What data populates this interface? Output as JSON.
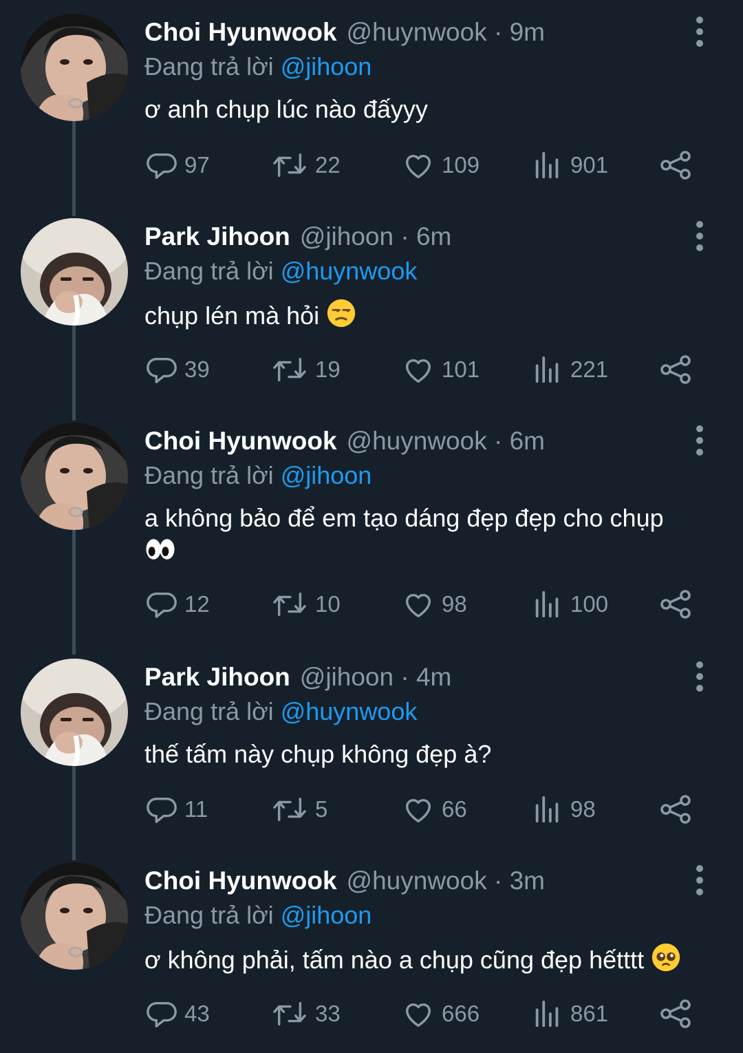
{
  "colors": {
    "background": "#15202b",
    "text": "#ffffff",
    "secondary": "#8b98a5",
    "mention": "#1d9bf0",
    "thread_line": "#3d4a57"
  },
  "icons": {
    "reply": "speech-bubble-icon",
    "retweet": "retweet-icon",
    "like": "heart-icon",
    "views": "bar-chart-icon",
    "share": "share-icon",
    "more": "more-vertical-icon"
  },
  "tweets": [
    {
      "name": "Choi Hyunwook",
      "meta": "@huynwook · 9m",
      "reply_prefix": "Đang trả lời",
      "reply_to": "@jihoon",
      "text": "ơ anh chụp lúc nào đấyyy",
      "emoji": "",
      "replies": "97",
      "retweets": "22",
      "likes": "109",
      "views": "901"
    },
    {
      "name": "Park Jihoon",
      "meta": "@jihoon · 6m",
      "reply_prefix": "Đang trả lời",
      "reply_to": "@huynwook",
      "text": "chụp lén mà hỏi",
      "emoji": "unamused-face",
      "replies": "39",
      "retweets": "19",
      "likes": "101",
      "views": "221"
    },
    {
      "name": "Choi Hyunwook",
      "meta": "@huynwook · 6m",
      "reply_prefix": "Đang trả lời",
      "reply_to": "@jihoon",
      "text": "a không bảo để em tạo dáng đẹp đẹp cho chụp",
      "emoji": "eyes",
      "replies": "12",
      "retweets": "10",
      "likes": "98",
      "views": "100"
    },
    {
      "name": "Park Jihoon",
      "meta": "@jihoon · 4m",
      "reply_prefix": "Đang trả lời",
      "reply_to": "@huynwook",
      "text": "thế tấm này chụp không đẹp à?",
      "emoji": "",
      "replies": "11",
      "retweets": "5",
      "likes": "66",
      "views": "98"
    },
    {
      "name": "Choi Hyunwook",
      "meta": "@huynwook · 3m",
      "reply_prefix": "Đang trả lời",
      "reply_to": "@jihoon",
      "text": "ơ không phải, tấm nào a chụp cũng đẹp hếtttt",
      "emoji": "pleading-face",
      "replies": "43",
      "retweets": "33",
      "likes": "666",
      "views": "861"
    }
  ]
}
